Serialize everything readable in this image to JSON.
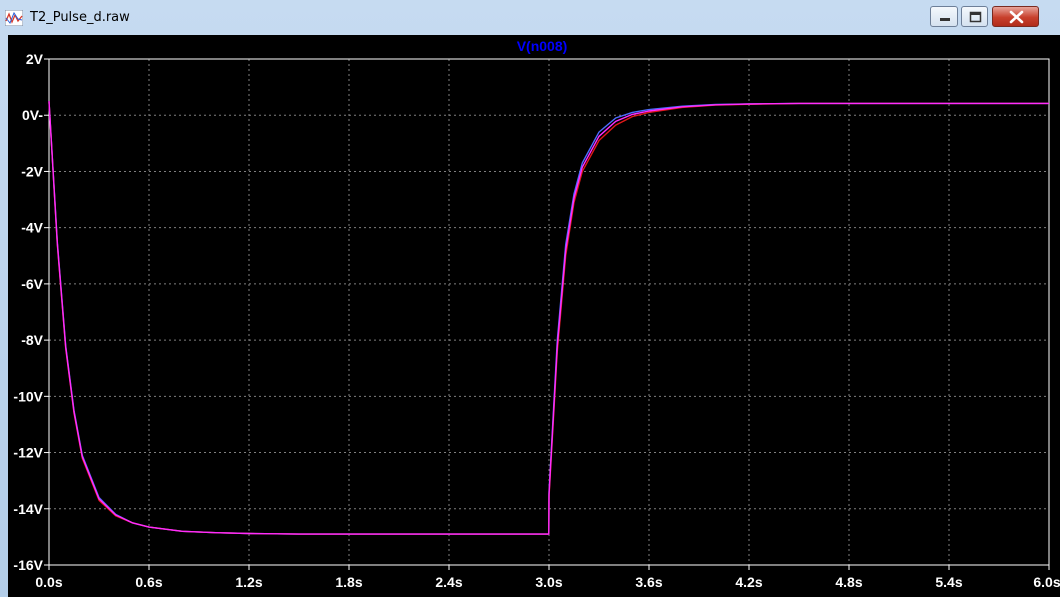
{
  "window": {
    "title": "T2_Pulse_d.raw",
    "icons": [
      "waveform-app-icon",
      "minimize-icon",
      "maximize-icon",
      "close-icon"
    ]
  },
  "colors": {
    "background": "#000000",
    "grid": "#7f7f7f",
    "axis_text": "#ffffff",
    "trace_title": "#0000ff",
    "trace_blue": "#4d6bff",
    "trace_red": "#e01818",
    "trace_magenta": "#ff2cff"
  },
  "chart_data": {
    "type": "line",
    "title": "V(n008)",
    "xlabel": "",
    "ylabel": "",
    "xlim": [
      0,
      6
    ],
    "ylim": [
      -16,
      2
    ],
    "grid": true,
    "x_ticks": [
      "0.0s",
      "0.6s",
      "1.2s",
      "1.8s",
      "2.4s",
      "3.0s",
      "3.6s",
      "4.2s",
      "4.8s",
      "5.4s",
      "6.0s"
    ],
    "y_ticks": [
      "2V",
      "0V-",
      "-2V",
      "-4V",
      "-6V",
      "-8V",
      "-10V",
      "-12V",
      "-14V",
      "-16V"
    ],
    "series": [
      {
        "color": "blue",
        "x": [
          0.0,
          0.05,
          0.1,
          0.15,
          0.2,
          0.3,
          0.4,
          0.5,
          0.6,
          0.8,
          1.0,
          1.2,
          1.5,
          1.8,
          2.4,
          2.999,
          3.0,
          3.05,
          3.1,
          3.15,
          3.2,
          3.3,
          3.4,
          3.5,
          3.6,
          3.8,
          4.0,
          4.2,
          4.5,
          5.0,
          6.0
        ],
        "y": [
          0.5,
          -4.5,
          -8.2,
          -10.5,
          -12.1,
          -13.6,
          -14.2,
          -14.5,
          -14.65,
          -14.8,
          -14.85,
          -14.88,
          -14.9,
          -14.9,
          -14.9,
          -14.9,
          -13.4,
          -8.0,
          -4.6,
          -2.8,
          -1.7,
          -0.6,
          -0.1,
          0.1,
          0.2,
          0.32,
          0.38,
          0.4,
          0.42,
          0.42,
          0.42
        ]
      },
      {
        "color": "red",
        "x": [
          0.0,
          0.05,
          0.1,
          0.15,
          0.2,
          0.3,
          0.4,
          0.5,
          0.6,
          0.8,
          1.0,
          1.2,
          1.5,
          1.8,
          2.4,
          2.999,
          3.0,
          3.05,
          3.1,
          3.15,
          3.2,
          3.3,
          3.4,
          3.5,
          3.6,
          3.8,
          4.0,
          4.2,
          4.5,
          5.0,
          6.0
        ],
        "y": [
          0.5,
          -4.6,
          -8.3,
          -10.6,
          -12.2,
          -13.7,
          -14.25,
          -14.5,
          -14.65,
          -14.8,
          -14.85,
          -14.88,
          -14.9,
          -14.9,
          -14.9,
          -14.9,
          -13.6,
          -8.4,
          -5.0,
          -3.1,
          -2.0,
          -0.9,
          -0.35,
          -0.05,
          0.1,
          0.28,
          0.36,
          0.39,
          0.42,
          0.42,
          0.42
        ]
      },
      {
        "color": "magenta",
        "x": [
          0.0,
          0.05,
          0.1,
          0.15,
          0.2,
          0.3,
          0.4,
          0.5,
          0.6,
          0.8,
          1.0,
          1.2,
          1.5,
          1.8,
          2.4,
          2.999,
          3.0,
          3.05,
          3.1,
          3.15,
          3.2,
          3.3,
          3.4,
          3.5,
          3.6,
          3.8,
          4.0,
          4.2,
          4.5,
          5.0,
          6.0
        ],
        "y": [
          0.5,
          -4.55,
          -8.25,
          -10.55,
          -12.15,
          -13.65,
          -14.22,
          -14.5,
          -14.65,
          -14.8,
          -14.85,
          -14.88,
          -14.9,
          -14.9,
          -14.9,
          -14.9,
          -13.5,
          -8.2,
          -4.8,
          -2.95,
          -1.85,
          -0.75,
          -0.22,
          0.03,
          0.15,
          0.3,
          0.37,
          0.4,
          0.42,
          0.42,
          0.42
        ]
      }
    ]
  }
}
